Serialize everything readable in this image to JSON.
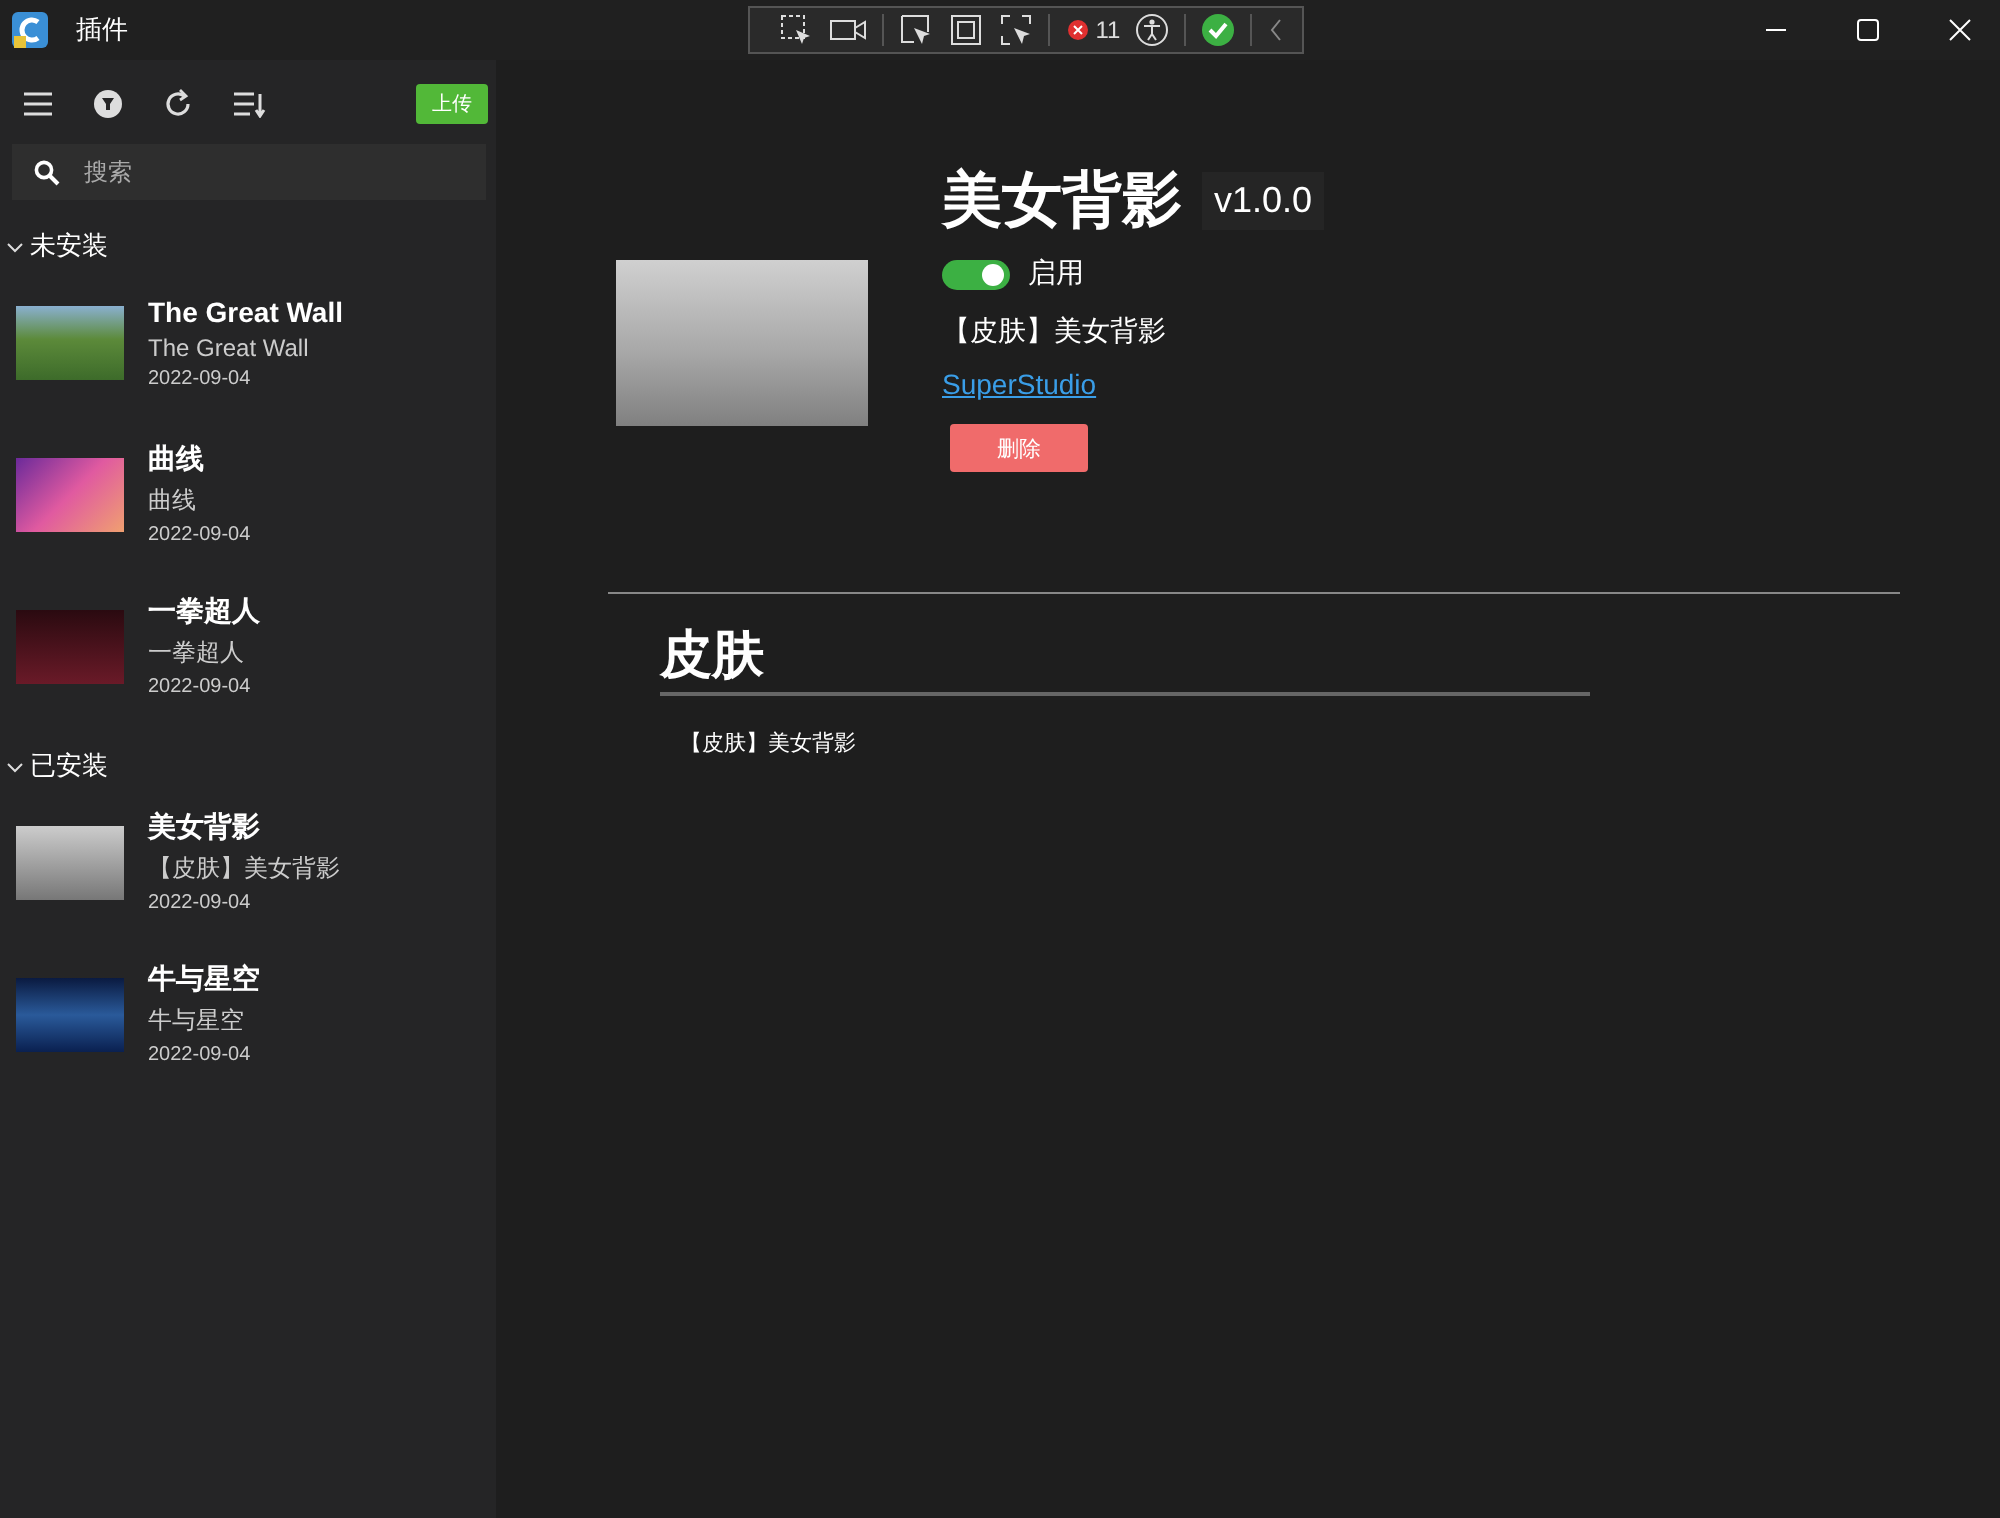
{
  "window": {
    "title": "插件"
  },
  "devtools": {
    "error_count": "11"
  },
  "sidebar": {
    "upload_button": "上传",
    "search": {
      "placeholder": "搜索"
    },
    "groups": [
      {
        "label": "未安装",
        "expanded": true,
        "items": [
          {
            "title": "The Great Wall",
            "subtitle": "The Great Wall",
            "date": "2022-09-04"
          },
          {
            "title": "曲线",
            "subtitle": "曲线",
            "date": "2022-09-04"
          },
          {
            "title": "一拳超人",
            "subtitle": "一拳超人",
            "date": "2022-09-04"
          }
        ]
      },
      {
        "label": "已安装",
        "expanded": true,
        "items": [
          {
            "title": "美女背影",
            "subtitle": "【皮肤】美女背影",
            "date": "2022-09-04"
          },
          {
            "title": "牛与星空",
            "subtitle": "牛与星空",
            "date": "2022-09-04"
          }
        ]
      }
    ]
  },
  "detail": {
    "title": "美女背影",
    "version": "v1.0.0",
    "enabled": true,
    "enabled_label": "启用",
    "description": "【皮肤】美女背影",
    "author_link": "SuperStudio",
    "delete_button": "删除",
    "section": {
      "heading": "皮肤",
      "text": "【皮肤】美女背影"
    }
  }
}
